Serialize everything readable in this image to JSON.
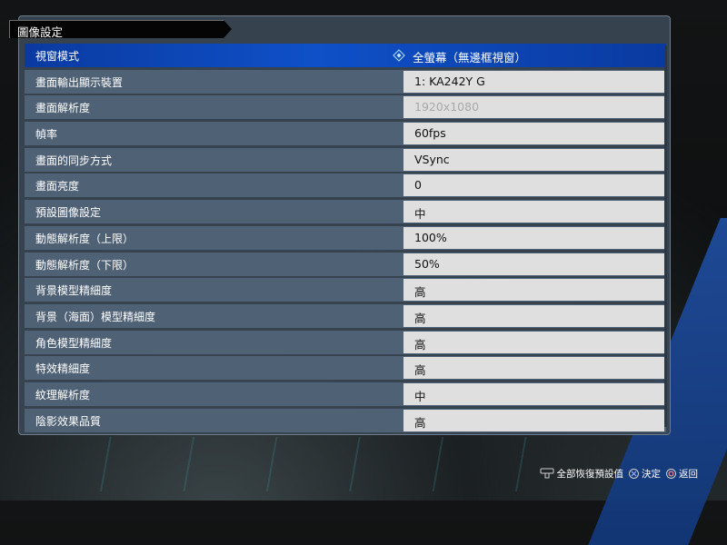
{
  "screen": {
    "title": "圖像設定"
  },
  "settings": [
    {
      "label": "視窗模式",
      "value": "全螢幕（無邊框視窗）",
      "selected": true
    },
    {
      "label": "畫面輸出顯示裝置",
      "value": "1: KA242Y G"
    },
    {
      "label": "畫面解析度",
      "value": "1920x1080",
      "disabled": true
    },
    {
      "label": "幀率",
      "value": "60fps"
    },
    {
      "label": "畫面的同步方式",
      "value": "VSync"
    },
    {
      "label": "畫面亮度",
      "value": "0"
    },
    {
      "label": "預設圖像設定",
      "value": "中"
    },
    {
      "label": "動態解析度（上限）",
      "value": "100%"
    },
    {
      "label": "動態解析度（下限）",
      "value": "50%"
    },
    {
      "label": "背景模型精細度",
      "value": "高"
    },
    {
      "label": "背景（海面）模型精細度",
      "value": "高"
    },
    {
      "label": "角色模型精細度",
      "value": "高"
    },
    {
      "label": "特效精細度",
      "value": "高"
    },
    {
      "label": "紋理解析度",
      "value": "中"
    },
    {
      "label": "陰影效果品質",
      "value": "高"
    }
  ],
  "footer": {
    "reset_label": "全部恢復預設值",
    "confirm_label": "決定",
    "back_label": "返回",
    "reset_icon": "touchpad-icon",
    "confirm_icon": "cross-button-icon",
    "back_icon": "circle-button-icon"
  },
  "colors": {
    "selected_row": "#0f50c8",
    "row_bg": "#4f6174",
    "value_bg": "#dfdfdf",
    "panel_bg": "#3a4652"
  }
}
